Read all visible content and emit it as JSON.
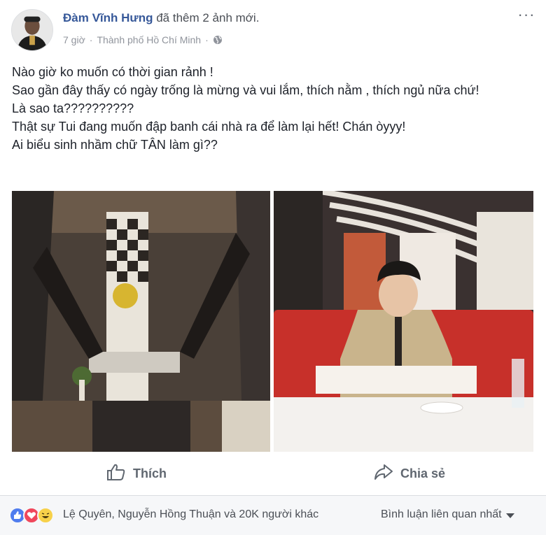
{
  "post": {
    "author": "Đàm Vĩnh Hưng",
    "action_text": " đã thêm 2 ảnh mới.",
    "time": "7 giờ",
    "separator_1": "·",
    "location": "Thành phố Hồ Chí Minh",
    "separator_2": "·",
    "privacy_icon": "globe-icon",
    "more_icon": "ellipsis-icon",
    "more_label": "···",
    "text_lines": [
      "Nào giờ ko muốn có thời gian rảnh !",
      "Sao gần đây thấy có ngày trống là mừng và vui lắm, thích nằm , thích ngủ nữa chứ!",
      "Là sao ta??????????",
      "Thật sự Tui đang muốn đập banh cái nhà ra để làm lại hết! Chán òyyy!",
      "Ai biểu sinh nhầm chữ TÂN làm gì??"
    ]
  },
  "actions": {
    "like_label": "Thích",
    "share_label": "Chia sẻ"
  },
  "reactions": {
    "icons": [
      "like-icon",
      "love-icon",
      "haha-icon"
    ],
    "summary": "Lệ Quyên, Nguyễn Hồng Thuận và 20K người khác",
    "sort_label": "Bình luận liên quan nhất"
  },
  "colors": {
    "author": "#365899",
    "like_blue": "#4f7cee",
    "love_red": "#f0475b",
    "haha_yellow": "#f7d14a",
    "action_gray": "#606770"
  }
}
